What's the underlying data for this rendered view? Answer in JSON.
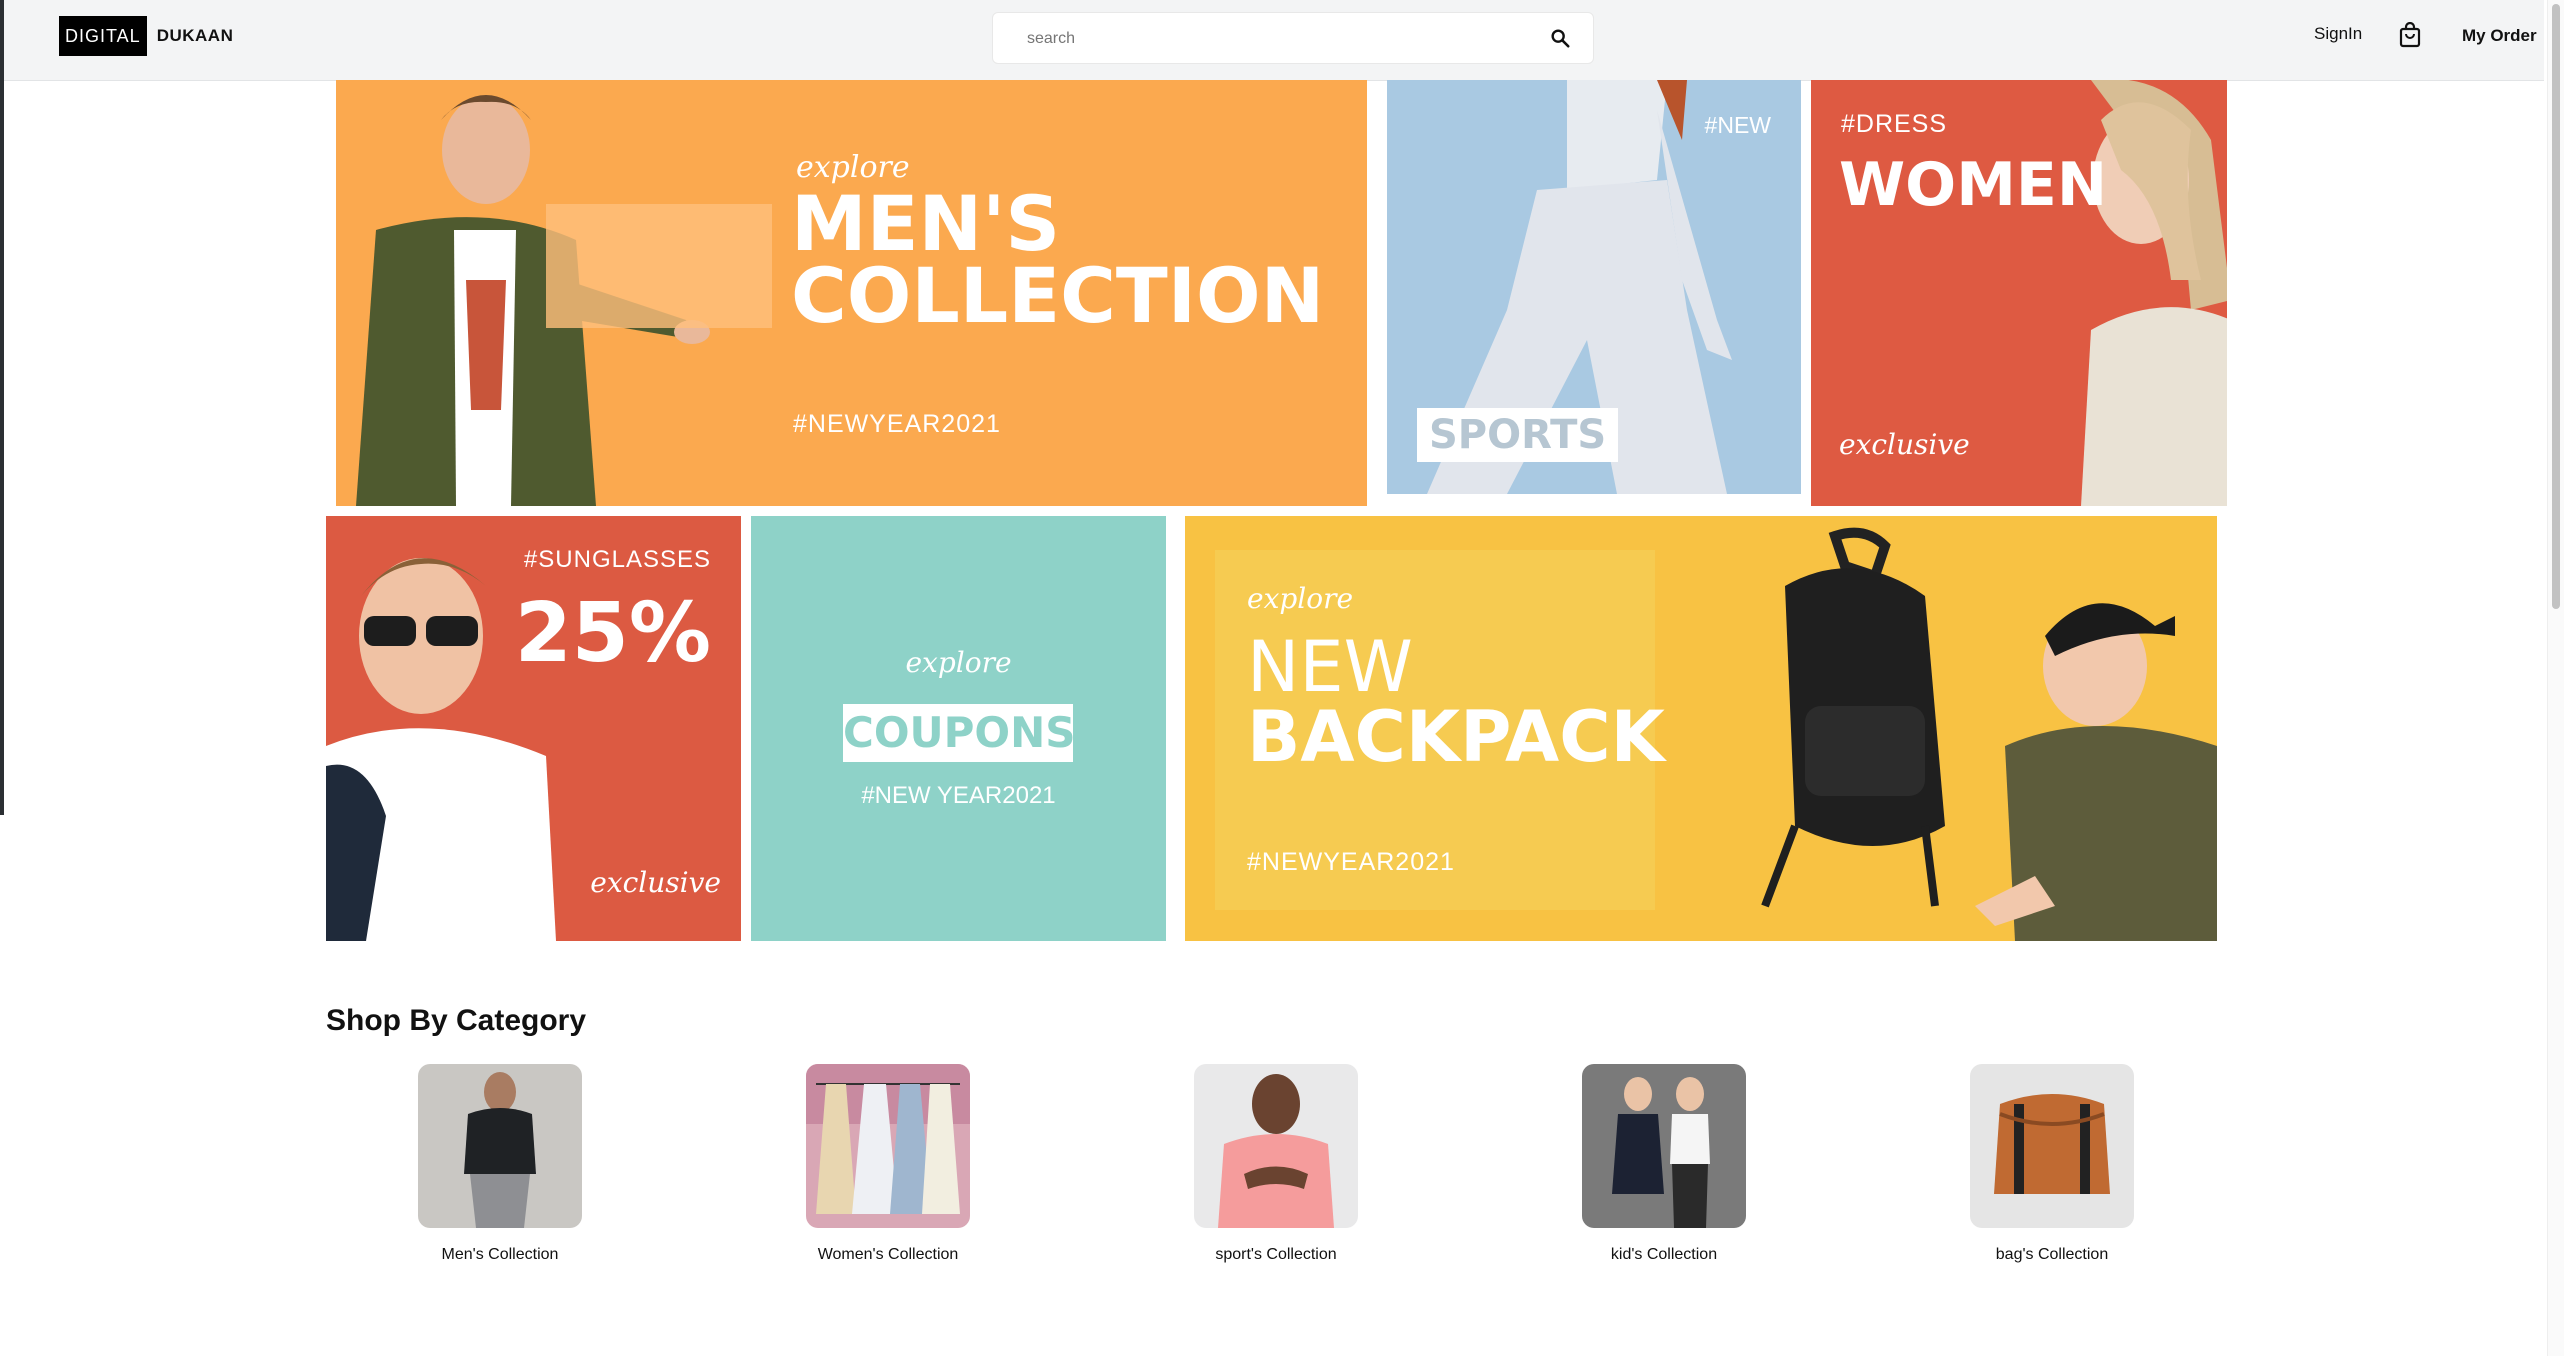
{
  "header": {
    "logo_box": "DIGITAL",
    "logo_text": "DUKAAN",
    "search_placeholder": "search",
    "signin": "SignIn",
    "my_order": "My Order"
  },
  "banners": {
    "men": {
      "explore": "explore",
      "title_line1": "MEN'S",
      "title_line2": "COLLECTION",
      "tag": "#NEWYEAR2021"
    },
    "sports": {
      "tag": "#NEW",
      "label": "SPORTS"
    },
    "women": {
      "tag": "#DRESS",
      "title": "WOMEN",
      "exclusive": "exclusive"
    },
    "sunglasses": {
      "tag": "#SUNGLASSES",
      "big": "25%",
      "exclusive": "exclusive"
    },
    "coupons": {
      "explore": "explore",
      "label": "COUPONS",
      "tag": "#NEW YEAR2021"
    },
    "backpack": {
      "explore": "explore",
      "title_line1": "NEW",
      "title_line2": "BACKPACK",
      "tag": "#NEWYEAR2021"
    }
  },
  "categories": {
    "heading": "Shop By Category",
    "items": [
      {
        "label": "Men's Collection"
      },
      {
        "label": "Women's Collection"
      },
      {
        "label": "sport's Collection"
      },
      {
        "label": "kid's Collection"
      },
      {
        "label": "bag's Collection"
      }
    ]
  },
  "colors": {
    "men": "#fba94f",
    "sports": "#a9c9e2",
    "women": "#de5a42",
    "sunglasses": "#dc5a42",
    "coupons": "#8ed2c8",
    "backpack": "#f8c243"
  },
  "icons": [
    "search-icon",
    "shopping-bag-icon"
  ]
}
